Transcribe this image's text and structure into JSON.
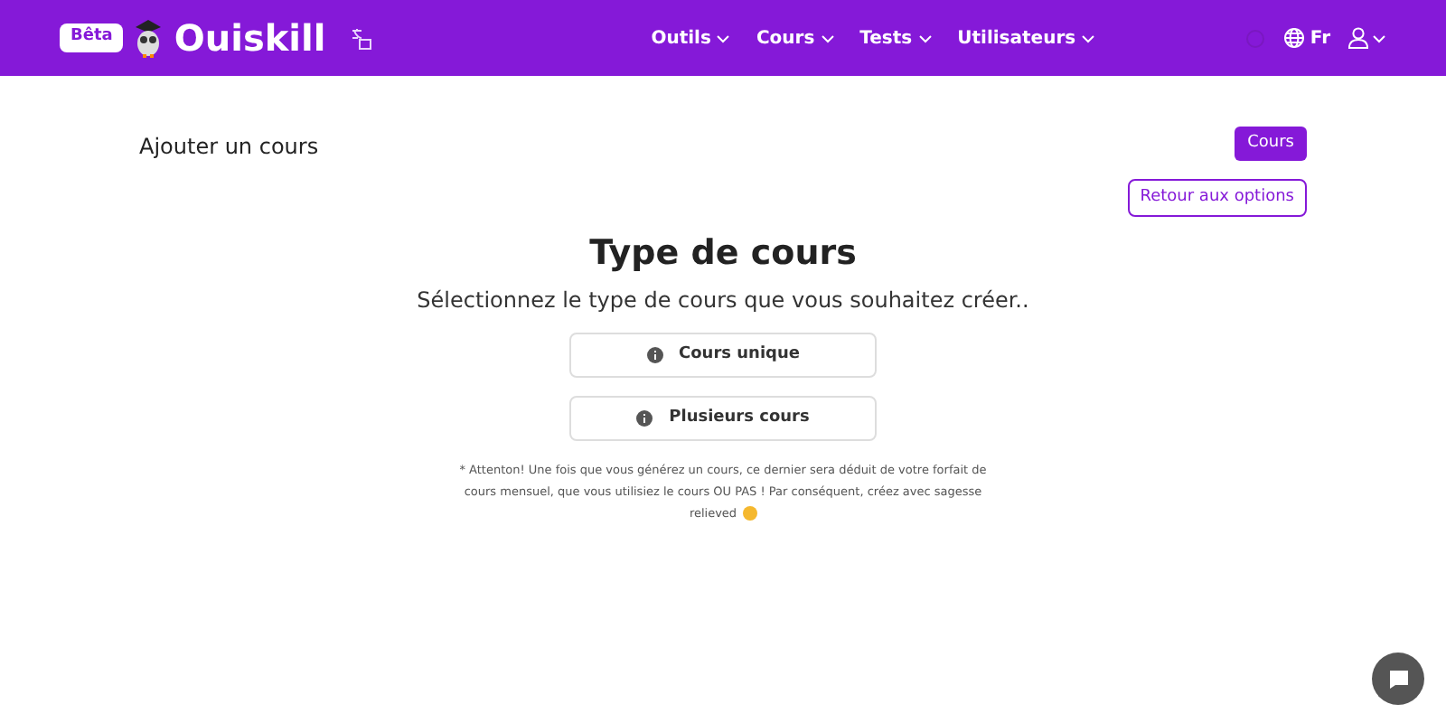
{
  "header": {
    "badge": "Bêta",
    "brand": "Ouiskill",
    "nav": [
      {
        "label": "Outils"
      },
      {
        "label": "Cours"
      },
      {
        "label": "Tests"
      },
      {
        "label": "Utilisateurs"
      }
    ],
    "language": "Fr"
  },
  "page": {
    "title": "Ajouter un cours",
    "tag_button": "Cours",
    "back_button": "Retour aux options"
  },
  "main": {
    "heading": "Type de cours",
    "subtitle": "Sélectionnez le type de cours que vous souhaitez créer..",
    "options": [
      {
        "label": "Cours unique"
      },
      {
        "label": "Plusieurs cours"
      }
    ],
    "note": "* Attenton! Une fois que vous générez un cours, ce dernier sera déduit de votre forfait de cours mensuel, que vous utilisiez le cours OU PAS ! Par conséquent, créez avec sagesse",
    "note_end": "relieved"
  }
}
